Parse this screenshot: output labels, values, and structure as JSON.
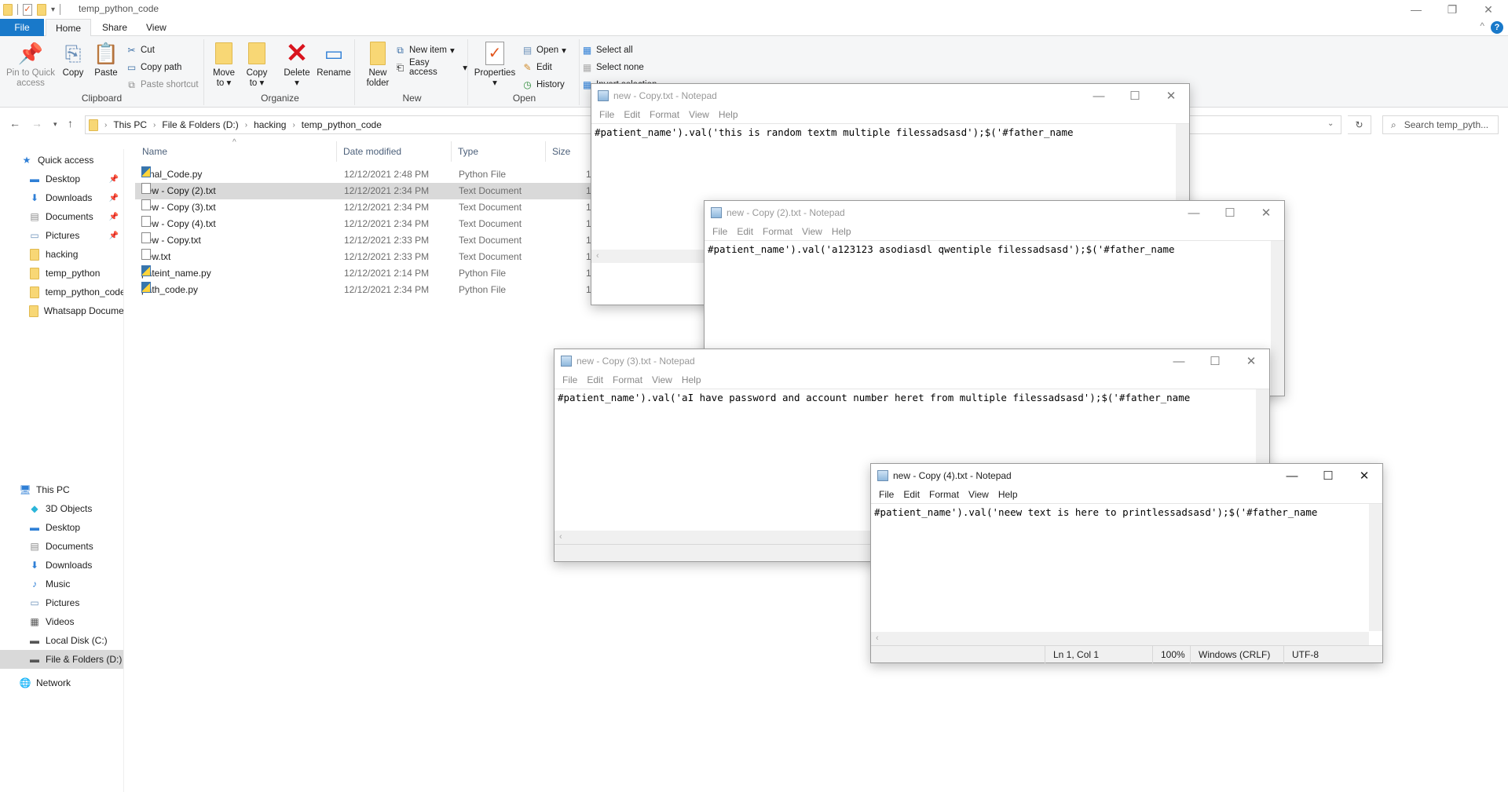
{
  "explorer": {
    "title": "temp_python_code",
    "tabs": [
      "File",
      "Home",
      "Share",
      "View"
    ],
    "ribbon": {
      "clipboard": {
        "label": "Clipboard",
        "pin": "Pin to Quick access",
        "copy": "Copy",
        "paste": "Paste",
        "cut": "Cut",
        "copy_path": "Copy path",
        "paste_shortcut": "Paste shortcut"
      },
      "organize": {
        "label": "Organize",
        "move_to": "Move to",
        "copy_to": "Copy to",
        "delete": "Delete",
        "rename": "Rename"
      },
      "new": {
        "label": "New",
        "new_folder": "New folder",
        "new_item": "New item",
        "easy_access": "Easy access"
      },
      "open": {
        "label": "Open",
        "properties": "Properties",
        "open": "Open",
        "edit": "Edit",
        "history": "History"
      },
      "select": {
        "select_all": "Select all",
        "select_none": "Select none",
        "invert_selection": "Invert selection"
      }
    },
    "breadcrumb": [
      "This PC",
      "File & Folders (D:)",
      "hacking",
      "temp_python_code"
    ],
    "search_placeholder": "Search temp_pyth...",
    "nav": {
      "quick_access": "Quick access",
      "quick_items": [
        {
          "label": "Desktop",
          "icon": "desktop-icon",
          "pinned": true
        },
        {
          "label": "Downloads",
          "icon": "download-icon",
          "pinned": true
        },
        {
          "label": "Documents",
          "icon": "documents-icon",
          "pinned": true
        },
        {
          "label": "Pictures",
          "icon": "pictures-icon",
          "pinned": true
        },
        {
          "label": "hacking",
          "icon": "folder-icon",
          "pinned": false
        },
        {
          "label": "temp_python",
          "icon": "folder-icon",
          "pinned": false
        },
        {
          "label": "temp_python_code",
          "icon": "folder-icon",
          "pinned": false
        },
        {
          "label": "Whatsapp Documents",
          "icon": "folder-icon",
          "pinned": false
        }
      ],
      "this_pc": "This PC",
      "pc_items": [
        {
          "label": "3D Objects",
          "icon": "3d-objects-icon"
        },
        {
          "label": "Desktop",
          "icon": "desktop-icon"
        },
        {
          "label": "Documents",
          "icon": "documents-icon"
        },
        {
          "label": "Downloads",
          "icon": "download-icon"
        },
        {
          "label": "Music",
          "icon": "music-icon"
        },
        {
          "label": "Pictures",
          "icon": "pictures-icon"
        },
        {
          "label": "Videos",
          "icon": "videos-icon"
        },
        {
          "label": "Local Disk (C:)",
          "icon": "drive-icon"
        },
        {
          "label": "File & Folders (D:)",
          "icon": "drive-icon",
          "selected": true
        }
      ],
      "network": "Network"
    },
    "columns": [
      "Name",
      "Date modified",
      "Type",
      "Size"
    ],
    "files": [
      {
        "name": "Final_Code.py",
        "date": "12/12/2021 2:48 PM",
        "type": "Python File",
        "size": "1",
        "kind": "py"
      },
      {
        "name": "new - Copy (2).txt",
        "date": "12/12/2021 2:34 PM",
        "type": "Text Document",
        "size": "1",
        "kind": "txt",
        "selected": true
      },
      {
        "name": "new - Copy (3).txt",
        "date": "12/12/2021 2:34 PM",
        "type": "Text Document",
        "size": "1",
        "kind": "txt"
      },
      {
        "name": "new - Copy (4).txt",
        "date": "12/12/2021 2:34 PM",
        "type": "Text Document",
        "size": "1",
        "kind": "txt"
      },
      {
        "name": "new - Copy.txt",
        "date": "12/12/2021 2:33 PM",
        "type": "Text Document",
        "size": "1",
        "kind": "txt"
      },
      {
        "name": "new.txt",
        "date": "12/12/2021 2:33 PM",
        "type": "Text Document",
        "size": "1",
        "kind": "txt"
      },
      {
        "name": "pateint_name.py",
        "date": "12/12/2021 2:14 PM",
        "type": "Python File",
        "size": "1",
        "kind": "py"
      },
      {
        "name": "path_code.py",
        "date": "12/12/2021 2:34 PM",
        "type": "Python File",
        "size": "1",
        "kind": "py"
      }
    ]
  },
  "notepad_menu": [
    "File",
    "Edit",
    "Format",
    "View",
    "Help"
  ],
  "notepads": [
    {
      "title": "new - Copy.txt - Notepad",
      "text": "#patient_name').val('this is random textm multiple filessadsasd');$('#father_name"
    },
    {
      "title": "new - Copy (2).txt - Notepad",
      "text": "#patient_name').val('a123123 asodiasdl qwentiple filessadsasd');$('#father_name"
    },
    {
      "title": "new - Copy (3).txt - Notepad",
      "text": "#patient_name').val('aI have password and account number heret from multiple filessadsasd');$('#father_name"
    },
    {
      "title": "new - Copy (4).txt - Notepad",
      "text": "#patient_name').val('neew text is here to printlessadsasd');$('#father_name",
      "status": {
        "position": "Ln 1, Col 1",
        "zoom": "100%",
        "line_ending": "Windows (CRLF)",
        "encoding": "UTF-8"
      }
    }
  ]
}
